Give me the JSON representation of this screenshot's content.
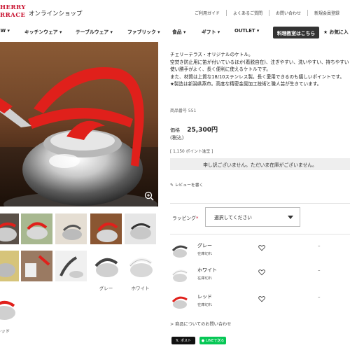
{
  "header": {
    "logo_line1": "HERRY",
    "logo_line2": "RRACE",
    "shop_name": "オンラインショップ",
    "util_links": [
      "ご利用ガイド",
      "よくあるご質問",
      "お問い合わせ",
      "新規会員登録"
    ]
  },
  "nav": {
    "items": [
      "EW ▾",
      "キッチンウェア ▾",
      "テーブルウェア ▾",
      "ファブリック ▾",
      "食品 ▾",
      "ギフト ▾",
      "OUTLET ▾"
    ],
    "cooking_class": "料理教室はこちら",
    "favorites": "★ お気に入"
  },
  "product": {
    "description": [
      "チェリーテラス・オリジナルのケトル。",
      "空焚き防止用に笛が付いているほか(着脱自在)、注ぎやすい、洗いやすい、持ちやすい",
      "使い勝手がよく、長く便利に使えるケトルです。",
      "また、材質は上質な18/10ステンレス製。長く愛用できるのも嬉しいポイントです。",
      "★製造は新潟県燕市。高度な精密金属加工技術と職人芸が生きています。"
    ],
    "sku": "商品番号 551",
    "price_label": "価格",
    "price": "25,300円",
    "tax": "(税込)",
    "points": "[ 1,150 ポイント進呈 ]",
    "soldout_message": "申し訳ございません。ただいま在庫がございません。",
    "review_link": "レビューを書く",
    "wrapping_label": "ラッピング",
    "wrapping_required": "*",
    "wrapping_placeholder": "選択してください",
    "variants": [
      {
        "name": "グレー",
        "stock": "在庫切れ",
        "quantity": "–"
      },
      {
        "name": "ホワイト",
        "stock": "在庫切れ",
        "quantity": "–"
      },
      {
        "name": "レッド",
        "stock": "在庫切れ",
        "quantity": "–"
      }
    ],
    "inquiry_link": "> 商品についてのお問い合わせ",
    "share_x": "ポスト",
    "share_line": "LINEで送る"
  },
  "gallery": {
    "captions": [
      "グレー",
      "ホワイト",
      "レッド"
    ]
  },
  "colors": {
    "brand_red": "#c8102e",
    "kettle_red": "#e0201b",
    "cooking_button_bg": "#333333",
    "line_green": "#06c755"
  },
  "icons": [
    "zoom-icon",
    "heart-icon",
    "pencil-icon",
    "x-logo-icon",
    "line-logo-icon",
    "chevron-down-icon"
  ]
}
